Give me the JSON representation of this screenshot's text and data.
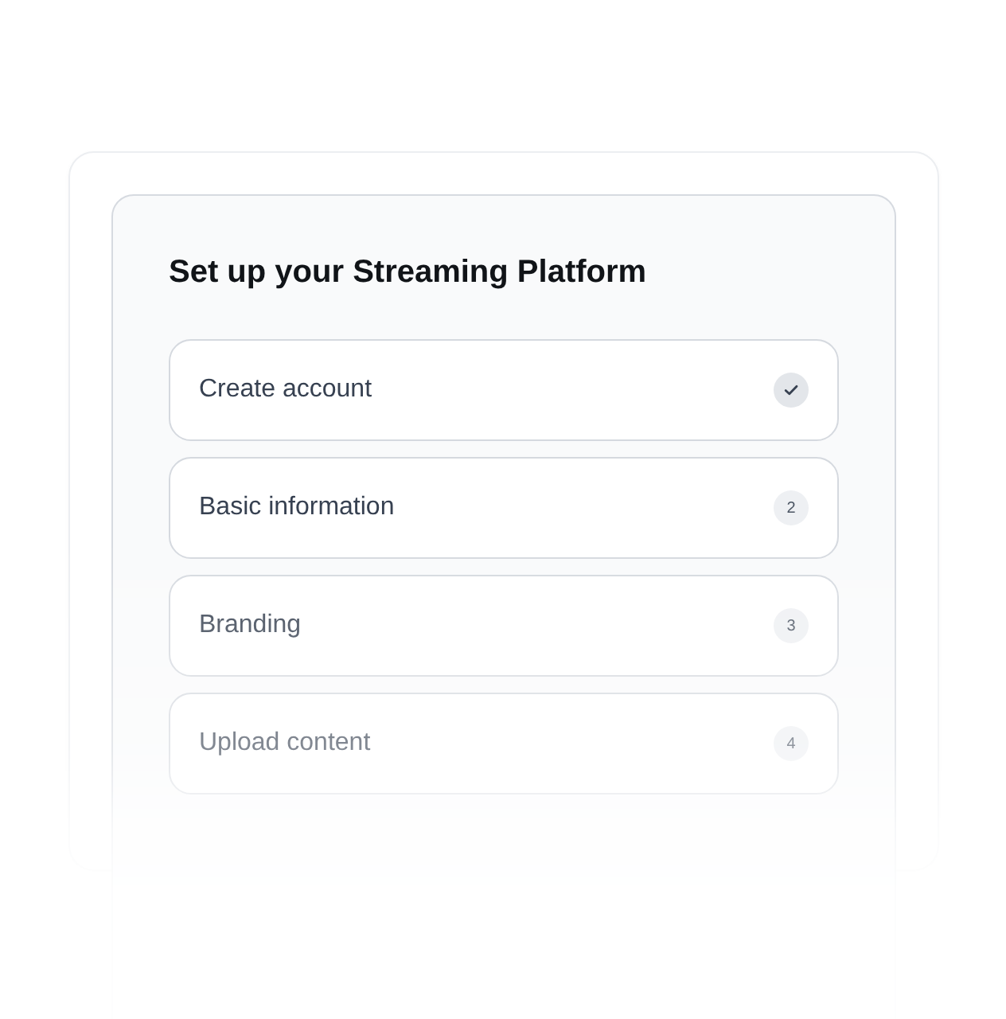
{
  "title": "Set up your Streaming Platform",
  "steps": [
    {
      "label": "Create account",
      "completed": true
    },
    {
      "label": "Basic information",
      "number": "2",
      "completed": false
    },
    {
      "label": "Branding",
      "number": "3",
      "completed": false
    },
    {
      "label": "Upload content",
      "number": "4",
      "completed": false
    }
  ]
}
